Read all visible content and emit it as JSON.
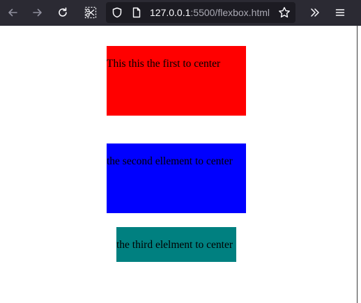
{
  "browser": {
    "url_host": "127.0.0.1",
    "url_rest": ":5500/flexbox.html",
    "icons": {
      "back": "back-arrow-icon",
      "forward": "forward-arrow-icon",
      "reload": "reload-icon",
      "screenshot": "screenshot-scissors-icon",
      "shield": "tracking-protection-shield-icon",
      "page": "page-info-icon",
      "bookmark": "bookmark-star-icon",
      "overflow": "overflow-chevrons-icon",
      "menu": "hamburger-menu-icon"
    },
    "colors": {
      "toolbar": "#2b2a33",
      "urlbar": "#1c1b22"
    }
  },
  "page": {
    "boxes": [
      {
        "text": "This this the first to center",
        "color": "#ff0000"
      },
      {
        "text": "the second ellement to center",
        "color": "#0000ff"
      },
      {
        "text": "the third elelment to center",
        "color": "#008080"
      }
    ]
  }
}
